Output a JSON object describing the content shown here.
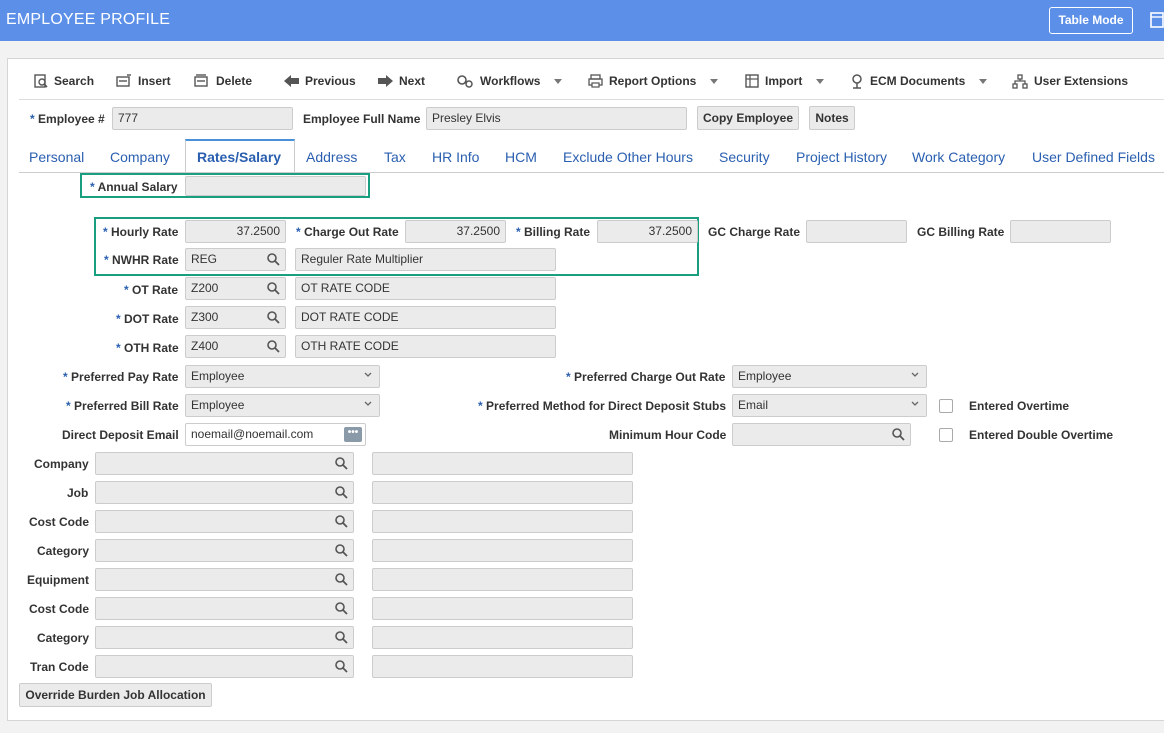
{
  "header": {
    "title": "EMPLOYEE PROFILE",
    "table_mode": "Table Mode"
  },
  "toolbar": {
    "search": "Search",
    "insert": "Insert",
    "delete": "Delete",
    "previous": "Previous",
    "next": "Next",
    "workflows": "Workflows",
    "report_options": "Report Options",
    "import": "Import",
    "ecm_documents": "ECM Documents",
    "user_extensions": "User Extensions"
  },
  "employee": {
    "number_label": "Employee #",
    "number_value": "777",
    "fullname_label": "Employee Full Name",
    "fullname_value": "Presley Elvis",
    "copy_employee": "Copy Employee",
    "notes": "Notes"
  },
  "tabs": [
    "Personal",
    "Company",
    "Rates/Salary",
    "Address",
    "Tax",
    "HR Info",
    "HCM",
    "Exclude Other Hours",
    "Security",
    "Project History",
    "Work Category",
    "User Defined Fields"
  ],
  "rates": {
    "annual_salary_label": "Annual Salary",
    "annual_salary_value": "",
    "hourly_rate_label": "Hourly Rate",
    "hourly_rate_value": "37.2500",
    "charge_out_rate_label": "Charge Out Rate",
    "charge_out_rate_value": "37.2500",
    "billing_rate_label": "Billing Rate",
    "billing_rate_value": "37.2500",
    "gc_charge_rate_label": "GC Charge Rate",
    "gc_charge_rate_value": "",
    "gc_billing_rate_label": "GC Billing Rate",
    "gc_billing_rate_value": "",
    "nwhr_label": "NWHR Rate",
    "nwhr_code": "REG",
    "nwhr_desc": "Reguler Rate Multiplier",
    "ot_label": "OT Rate",
    "ot_code": "Z200",
    "ot_desc": "OT RATE CODE",
    "dot_label": "DOT Rate",
    "dot_code": "Z300",
    "dot_desc": "DOT RATE CODE",
    "oth_label": "OTH Rate",
    "oth_code": "Z400",
    "oth_desc": "OTH RATE CODE"
  },
  "prefs": {
    "pref_pay_label": "Preferred Pay Rate",
    "pref_pay_value": "Employee",
    "pref_charge_label": "Preferred Charge Out Rate",
    "pref_charge_value": "Employee",
    "pref_bill_label": "Preferred Bill Rate",
    "pref_bill_value": "Employee",
    "pref_method_label": "Preferred Method for Direct Deposit Stubs",
    "pref_method_value": "Email",
    "entered_overtime": "Entered Overtime",
    "dd_email_label": "Direct Deposit Email",
    "dd_email_value": "noemail@noemail.com",
    "min_hour_label": "Minimum Hour Code",
    "entered_double_overtime": "Entered Double Overtime"
  },
  "alloc": {
    "company": "Company",
    "job": "Job",
    "cost_code": "Cost Code",
    "category": "Category",
    "equipment": "Equipment",
    "cost_code2": "Cost Code",
    "category2": "Category",
    "tran_code": "Tran Code",
    "override_button": "Override Burden Job Allocation"
  },
  "colors": {
    "header": "#5b8fe8",
    "highlight": "#1a9e80",
    "tab_text": "#2a5fb0"
  }
}
